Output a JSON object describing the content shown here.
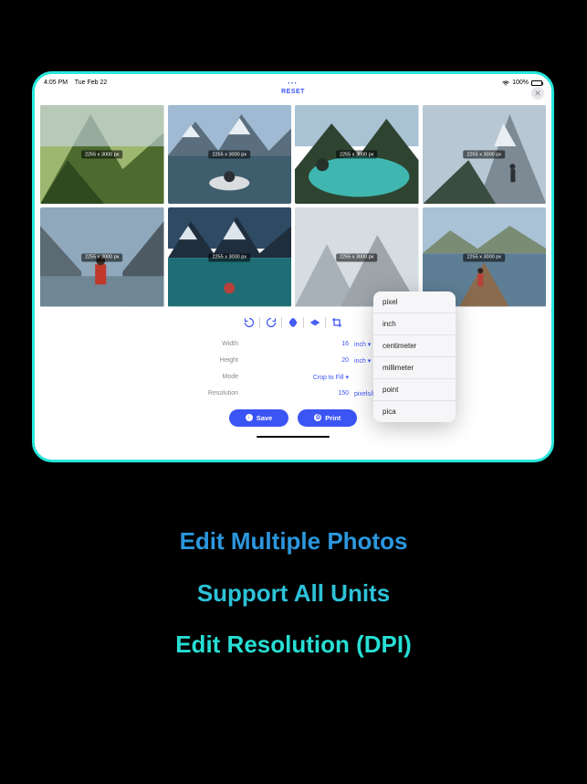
{
  "statusbar": {
    "time": "4:05 PM",
    "date": "Tue Feb 22",
    "battery": "100%"
  },
  "header": {
    "reset": "RESET"
  },
  "thumbs": [
    {
      "dim": "2255 x 3000 px"
    },
    {
      "dim": "2255 x 3000 px"
    },
    {
      "dim": "2255 x 3000 px"
    },
    {
      "dim": "2255 x 3000 px"
    },
    {
      "dim": "2255 x 3000 px"
    },
    {
      "dim": "2255 x 3000 px"
    },
    {
      "dim": "2255 x 3000 px"
    },
    {
      "dim": "2255 x 3000 px"
    }
  ],
  "units_menu": [
    "pixel",
    "inch",
    "centimeter",
    "millimeter",
    "point",
    "pica"
  ],
  "form": {
    "width_label": "Width",
    "width_value": "16",
    "width_unit": "inch ▾",
    "height_label": "Height",
    "height_value": "20",
    "height_unit": "inch ▾",
    "mode_label": "Mode",
    "mode_value": "Crop to Fill ▾",
    "res_label": "Resolution",
    "res_value": "150",
    "res_unit": "pixels/inch ▾"
  },
  "actions": {
    "save": "Save",
    "print": "Print"
  },
  "captions": {
    "line1": "Edit Multiple Photos",
    "line2": "Support All Units",
    "line3": "Edit Resolution (DPI)"
  }
}
